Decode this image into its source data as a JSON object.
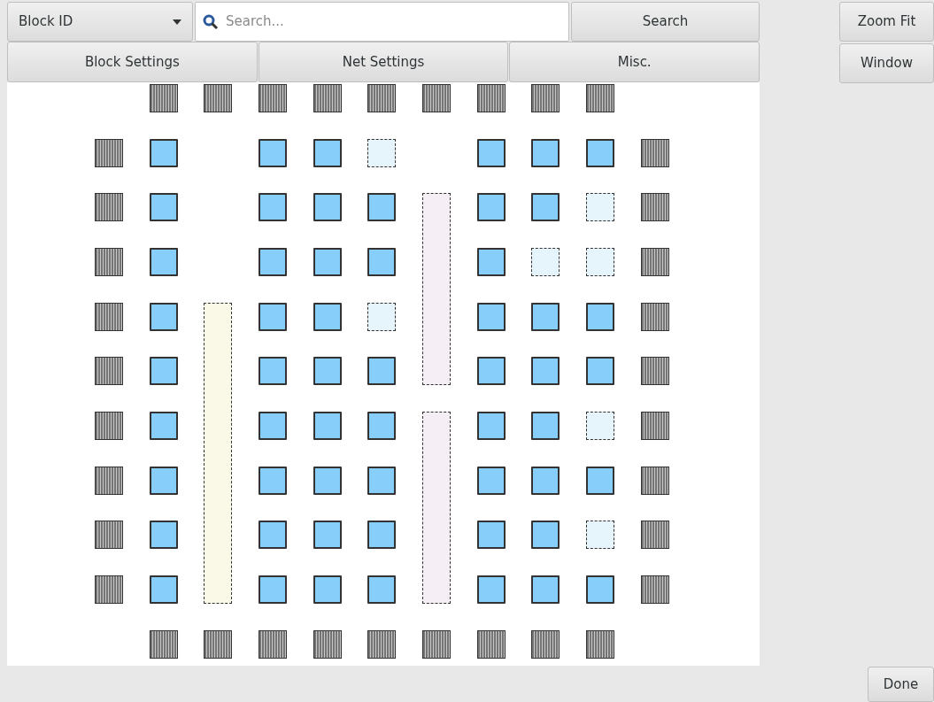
{
  "toolbar": {
    "dropdown": {
      "value": "Block ID"
    },
    "search": {
      "placeholder": "Search..."
    },
    "search_button": "Search",
    "tabs": [
      {
        "label": "Block Settings"
      },
      {
        "label": "Net Settings"
      },
      {
        "label": "Misc."
      }
    ]
  },
  "side_panel": {
    "buttons": [
      "Zoom Fit",
      "Window"
    ]
  },
  "grid": {
    "rows": [
      [
        {
          "kind": "empty"
        },
        {
          "kind": "io"
        },
        {
          "kind": "io"
        },
        {
          "kind": "io"
        },
        {
          "kind": "io"
        },
        {
          "kind": "io"
        },
        {
          "kind": "io"
        },
        {
          "kind": "io"
        },
        {
          "kind": "io"
        },
        {
          "kind": "io"
        },
        {
          "kind": "empty"
        }
      ],
      [
        {
          "kind": "io"
        },
        {
          "kind": "clb",
          "used": true
        },
        {
          "kind": "empty"
        },
        {
          "kind": "clb",
          "used": true
        },
        {
          "kind": "clb",
          "used": true
        },
        {
          "kind": "clb",
          "used": false
        },
        {
          "kind": "empty"
        },
        {
          "kind": "clb",
          "used": true
        },
        {
          "kind": "clb",
          "used": true
        },
        {
          "kind": "clb",
          "used": true
        },
        {
          "kind": "io"
        }
      ],
      [
        {
          "kind": "io"
        },
        {
          "kind": "clb",
          "used": true
        },
        {
          "kind": "empty"
        },
        {
          "kind": "clb",
          "used": true
        },
        {
          "kind": "clb",
          "used": true
        },
        {
          "kind": "clb",
          "used": true
        },
        {
          "kind": "mult",
          "used": false
        },
        {
          "kind": "clb",
          "used": true
        },
        {
          "kind": "clb",
          "used": true
        },
        {
          "kind": "clb",
          "used": false
        },
        {
          "kind": "io"
        }
      ],
      [
        {
          "kind": "io"
        },
        {
          "kind": "clb",
          "used": true
        },
        {
          "kind": "empty"
        },
        {
          "kind": "clb",
          "used": true
        },
        {
          "kind": "clb",
          "used": true
        },
        {
          "kind": "clb",
          "used": true
        },
        {
          "kind": "covered"
        },
        {
          "kind": "clb",
          "used": true
        },
        {
          "kind": "clb",
          "used": false
        },
        {
          "kind": "clb",
          "used": false
        },
        {
          "kind": "io"
        }
      ],
      [
        {
          "kind": "io"
        },
        {
          "kind": "clb",
          "used": true
        },
        {
          "kind": "mem",
          "used": false
        },
        {
          "kind": "clb",
          "used": true
        },
        {
          "kind": "clb",
          "used": true
        },
        {
          "kind": "clb",
          "used": false
        },
        {
          "kind": "covered"
        },
        {
          "kind": "clb",
          "used": true
        },
        {
          "kind": "clb",
          "used": true
        },
        {
          "kind": "clb",
          "used": true
        },
        {
          "kind": "io"
        }
      ],
      [
        {
          "kind": "io"
        },
        {
          "kind": "clb",
          "used": true
        },
        {
          "kind": "covered"
        },
        {
          "kind": "clb",
          "used": true
        },
        {
          "kind": "clb",
          "used": true
        },
        {
          "kind": "clb",
          "used": true
        },
        {
          "kind": "covered"
        },
        {
          "kind": "clb",
          "used": true
        },
        {
          "kind": "clb",
          "used": true
        },
        {
          "kind": "clb",
          "used": true
        },
        {
          "kind": "io"
        }
      ],
      [
        {
          "kind": "io"
        },
        {
          "kind": "clb",
          "used": true
        },
        {
          "kind": "covered"
        },
        {
          "kind": "clb",
          "used": true
        },
        {
          "kind": "clb",
          "used": true
        },
        {
          "kind": "clb",
          "used": true
        },
        {
          "kind": "mult",
          "used": false
        },
        {
          "kind": "clb",
          "used": true
        },
        {
          "kind": "clb",
          "used": true
        },
        {
          "kind": "clb",
          "used": false
        },
        {
          "kind": "io"
        }
      ],
      [
        {
          "kind": "io"
        },
        {
          "kind": "clb",
          "used": true
        },
        {
          "kind": "covered"
        },
        {
          "kind": "clb",
          "used": true
        },
        {
          "kind": "clb",
          "used": true
        },
        {
          "kind": "clb",
          "used": true
        },
        {
          "kind": "covered"
        },
        {
          "kind": "clb",
          "used": true
        },
        {
          "kind": "clb",
          "used": true
        },
        {
          "kind": "clb",
          "used": true
        },
        {
          "kind": "io"
        }
      ],
      [
        {
          "kind": "io"
        },
        {
          "kind": "clb",
          "used": true
        },
        {
          "kind": "covered"
        },
        {
          "kind": "clb",
          "used": true
        },
        {
          "kind": "clb",
          "used": true
        },
        {
          "kind": "clb",
          "used": true
        },
        {
          "kind": "covered"
        },
        {
          "kind": "clb",
          "used": true
        },
        {
          "kind": "clb",
          "used": true
        },
        {
          "kind": "clb",
          "used": false
        },
        {
          "kind": "io"
        }
      ],
      [
        {
          "kind": "io"
        },
        {
          "kind": "clb",
          "used": true
        },
        {
          "kind": "covered"
        },
        {
          "kind": "clb",
          "used": true
        },
        {
          "kind": "clb",
          "used": true
        },
        {
          "kind": "clb",
          "used": true
        },
        {
          "kind": "covered"
        },
        {
          "kind": "clb",
          "used": true
        },
        {
          "kind": "clb",
          "used": true
        },
        {
          "kind": "clb",
          "used": true
        },
        {
          "kind": "io"
        }
      ],
      [
        {
          "kind": "empty"
        },
        {
          "kind": "io"
        },
        {
          "kind": "io"
        },
        {
          "kind": "io"
        },
        {
          "kind": "io"
        },
        {
          "kind": "io"
        },
        {
          "kind": "io"
        },
        {
          "kind": "io"
        },
        {
          "kind": "io"
        },
        {
          "kind": "io"
        },
        {
          "kind": "empty"
        }
      ]
    ]
  },
  "done_button": "Done"
}
